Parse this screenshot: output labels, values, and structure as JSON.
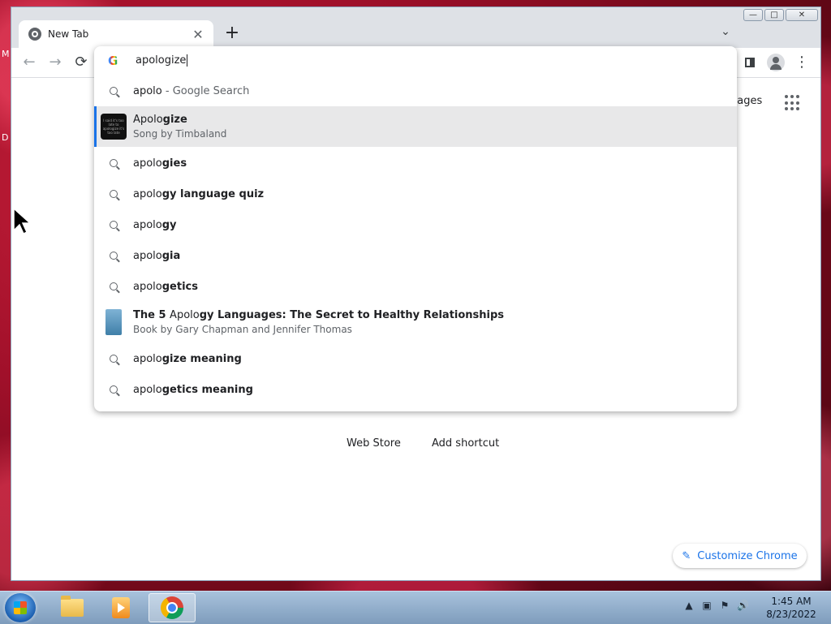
{
  "desktop": {
    "edge_text_top": "M",
    "edge_text_mid": "D"
  },
  "browser": {
    "tab_title": "New Tab",
    "tab_close": "✕",
    "new_tab": "+",
    "tab_search": "⌄",
    "window_controls": {
      "minimize": "—",
      "maximize": "□",
      "close": "✕"
    },
    "nav": {
      "back": "←",
      "forward": "→",
      "reload": "⟳",
      "menu": "⋮"
    }
  },
  "omnibox": {
    "input_value": "apologize",
    "suggestions": [
      {
        "type": "search",
        "prefix": "apolo",
        "bold": "",
        "suffix": " - Google Search"
      },
      {
        "type": "entity",
        "prefix": "Apolo",
        "bold": "gize",
        "subtitle": "Song by Timbaland",
        "thumb_text": "I said it's too late to apologize it's too late",
        "selected": true
      },
      {
        "type": "search",
        "prefix": "apolo",
        "bold": "gies"
      },
      {
        "type": "search",
        "prefix": "apolo",
        "bold": "gy language quiz"
      },
      {
        "type": "search",
        "prefix": "apolo",
        "bold": "gy"
      },
      {
        "type": "search",
        "prefix": "apolo",
        "bold": "gia"
      },
      {
        "type": "search",
        "prefix": "apolo",
        "bold": "getics"
      },
      {
        "type": "entity",
        "pre_bold": "The 5 ",
        "prefix": "Apolo",
        "bold": "gy Languages: The Secret to Healthy Relationships",
        "subtitle": "Book by Gary Chapman and Jennifer Thomas"
      },
      {
        "type": "search",
        "prefix": "apolo",
        "bold": "gize meaning"
      },
      {
        "type": "search",
        "prefix": "apolo",
        "bold": "getics meaning"
      }
    ]
  },
  "ntp": {
    "images_link": "nages",
    "shortcuts": [
      "Web Store",
      "Add shortcut"
    ],
    "customize_label": "Customize Chrome",
    "customize_icon": "✎"
  },
  "taskbar": {
    "time": "1:45 AM",
    "date": "8/23/2022",
    "tray_icons": [
      "▲",
      "▣",
      "⚑",
      "🔊"
    ]
  }
}
